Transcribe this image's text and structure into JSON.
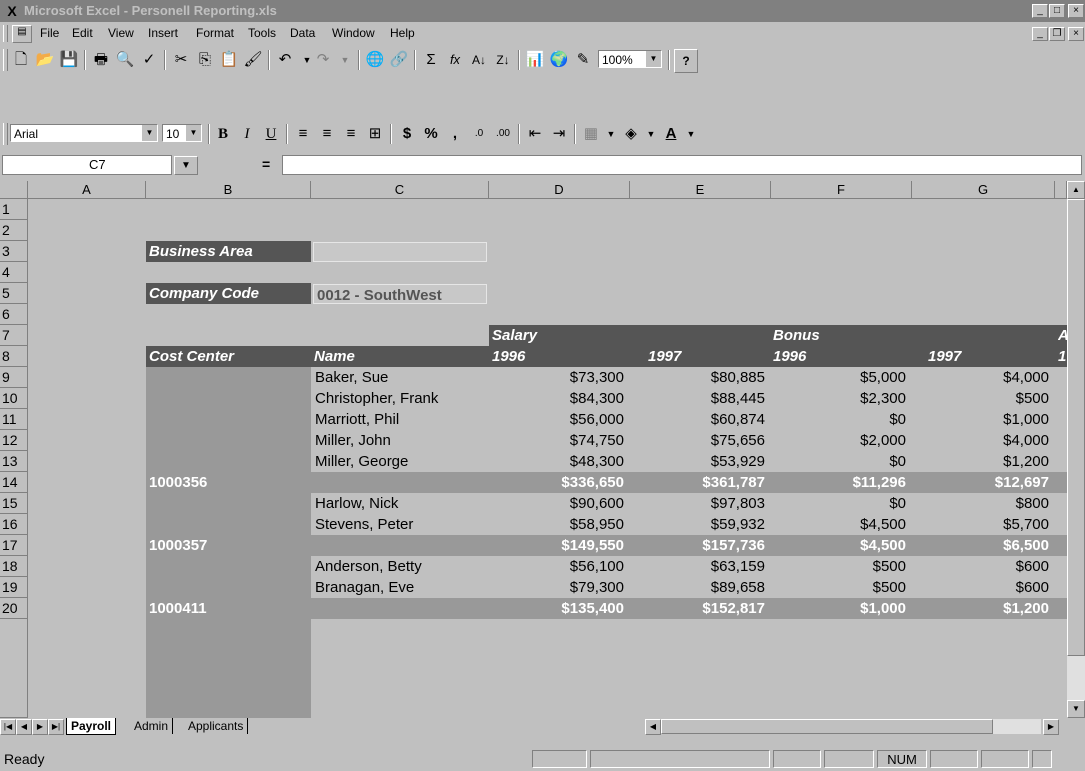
{
  "window": {
    "title": "Microsoft Excel - Personell Reporting.xls",
    "min": "_",
    "max": "□",
    "close": "×"
  },
  "menu": [
    "File",
    "Edit",
    "View",
    "Insert",
    "Format",
    "Tools",
    "Data",
    "Window",
    "Help"
  ],
  "toolbar": {
    "zoom": "100%",
    "font": "Arial",
    "size": "10",
    "bold": "B",
    "italic": "I",
    "underline": "U",
    "currency": "$",
    "percent": "%",
    "comma": ",",
    "sigma": "Σ",
    "fx": "fx",
    "help": "?"
  },
  "formula": {
    "cell_ref": "C7",
    "equals": "="
  },
  "columns": [
    "A",
    "B",
    "C",
    "D",
    "E",
    "F",
    "G"
  ],
  "rows": [
    "1",
    "2",
    "3",
    "4",
    "5",
    "6",
    "7",
    "8",
    "9",
    "10",
    "11",
    "12",
    "13",
    "14",
    "15",
    "16",
    "17",
    "18",
    "19",
    "20"
  ],
  "sheet": {
    "business_area_label": "Business Area",
    "business_area_value": "",
    "company_code_label": "Company Code",
    "company_code_value": "0012 - SouthWest",
    "salary_header": "Salary",
    "bonus_header": "Bonus",
    "trailing_header": "A",
    "cost_center_header": "Cost Center",
    "name_header": "Name",
    "y1996_d": "1996",
    "y1997_e": "1997",
    "y1996_f": "1996",
    "y1997_g": "1997",
    "trailing_year": "1",
    "data_rows": [
      {
        "name": "Baker, Sue",
        "d": "$73,300",
        "e": "$80,885",
        "f": "$5,000",
        "g": "$4,000"
      },
      {
        "name": "Christopher, Frank",
        "d": "$84,300",
        "e": "$88,445",
        "f": "$2,300",
        "g": "$500"
      },
      {
        "name": "Marriott, Phil",
        "d": "$56,000",
        "e": "$60,874",
        "f": "$0",
        "g": "$1,000"
      },
      {
        "name": "Miller, John",
        "d": "$74,750",
        "e": "$75,656",
        "f": "$2,000",
        "g": "$4,000"
      },
      {
        "name": "Miller, George",
        "d": "$48,300",
        "e": "$53,929",
        "f": "$0",
        "g": "$1,200"
      },
      {
        "cc": "1000356",
        "d": "$336,650",
        "e": "$361,787",
        "f": "$11,296",
        "g": "$12,697"
      },
      {
        "name": "Harlow, Nick",
        "d": "$90,600",
        "e": "$97,803",
        "f": "$0",
        "g": "$800"
      },
      {
        "name": "Stevens, Peter",
        "d": "$58,950",
        "e": "$59,932",
        "f": "$4,500",
        "g": "$5,700"
      },
      {
        "cc": "1000357",
        "d": "$149,550",
        "e": "$157,736",
        "f": "$4,500",
        "g": "$6,500"
      },
      {
        "name": "Anderson, Betty",
        "d": "$56,100",
        "e": "$63,159",
        "f": "$500",
        "g": "$600"
      },
      {
        "name": "Branagan, Eve",
        "d": "$79,300",
        "e": "$89,658",
        "f": "$500",
        "g": "$600"
      },
      {
        "cc": "1000411",
        "d": "$135,400",
        "e": "$152,817",
        "f": "$1,000",
        "g": "$1,200"
      }
    ]
  },
  "tabs": [
    "Payroll",
    "Admin",
    "Applicants"
  ],
  "status": {
    "text": "Ready",
    "num": "NUM"
  }
}
